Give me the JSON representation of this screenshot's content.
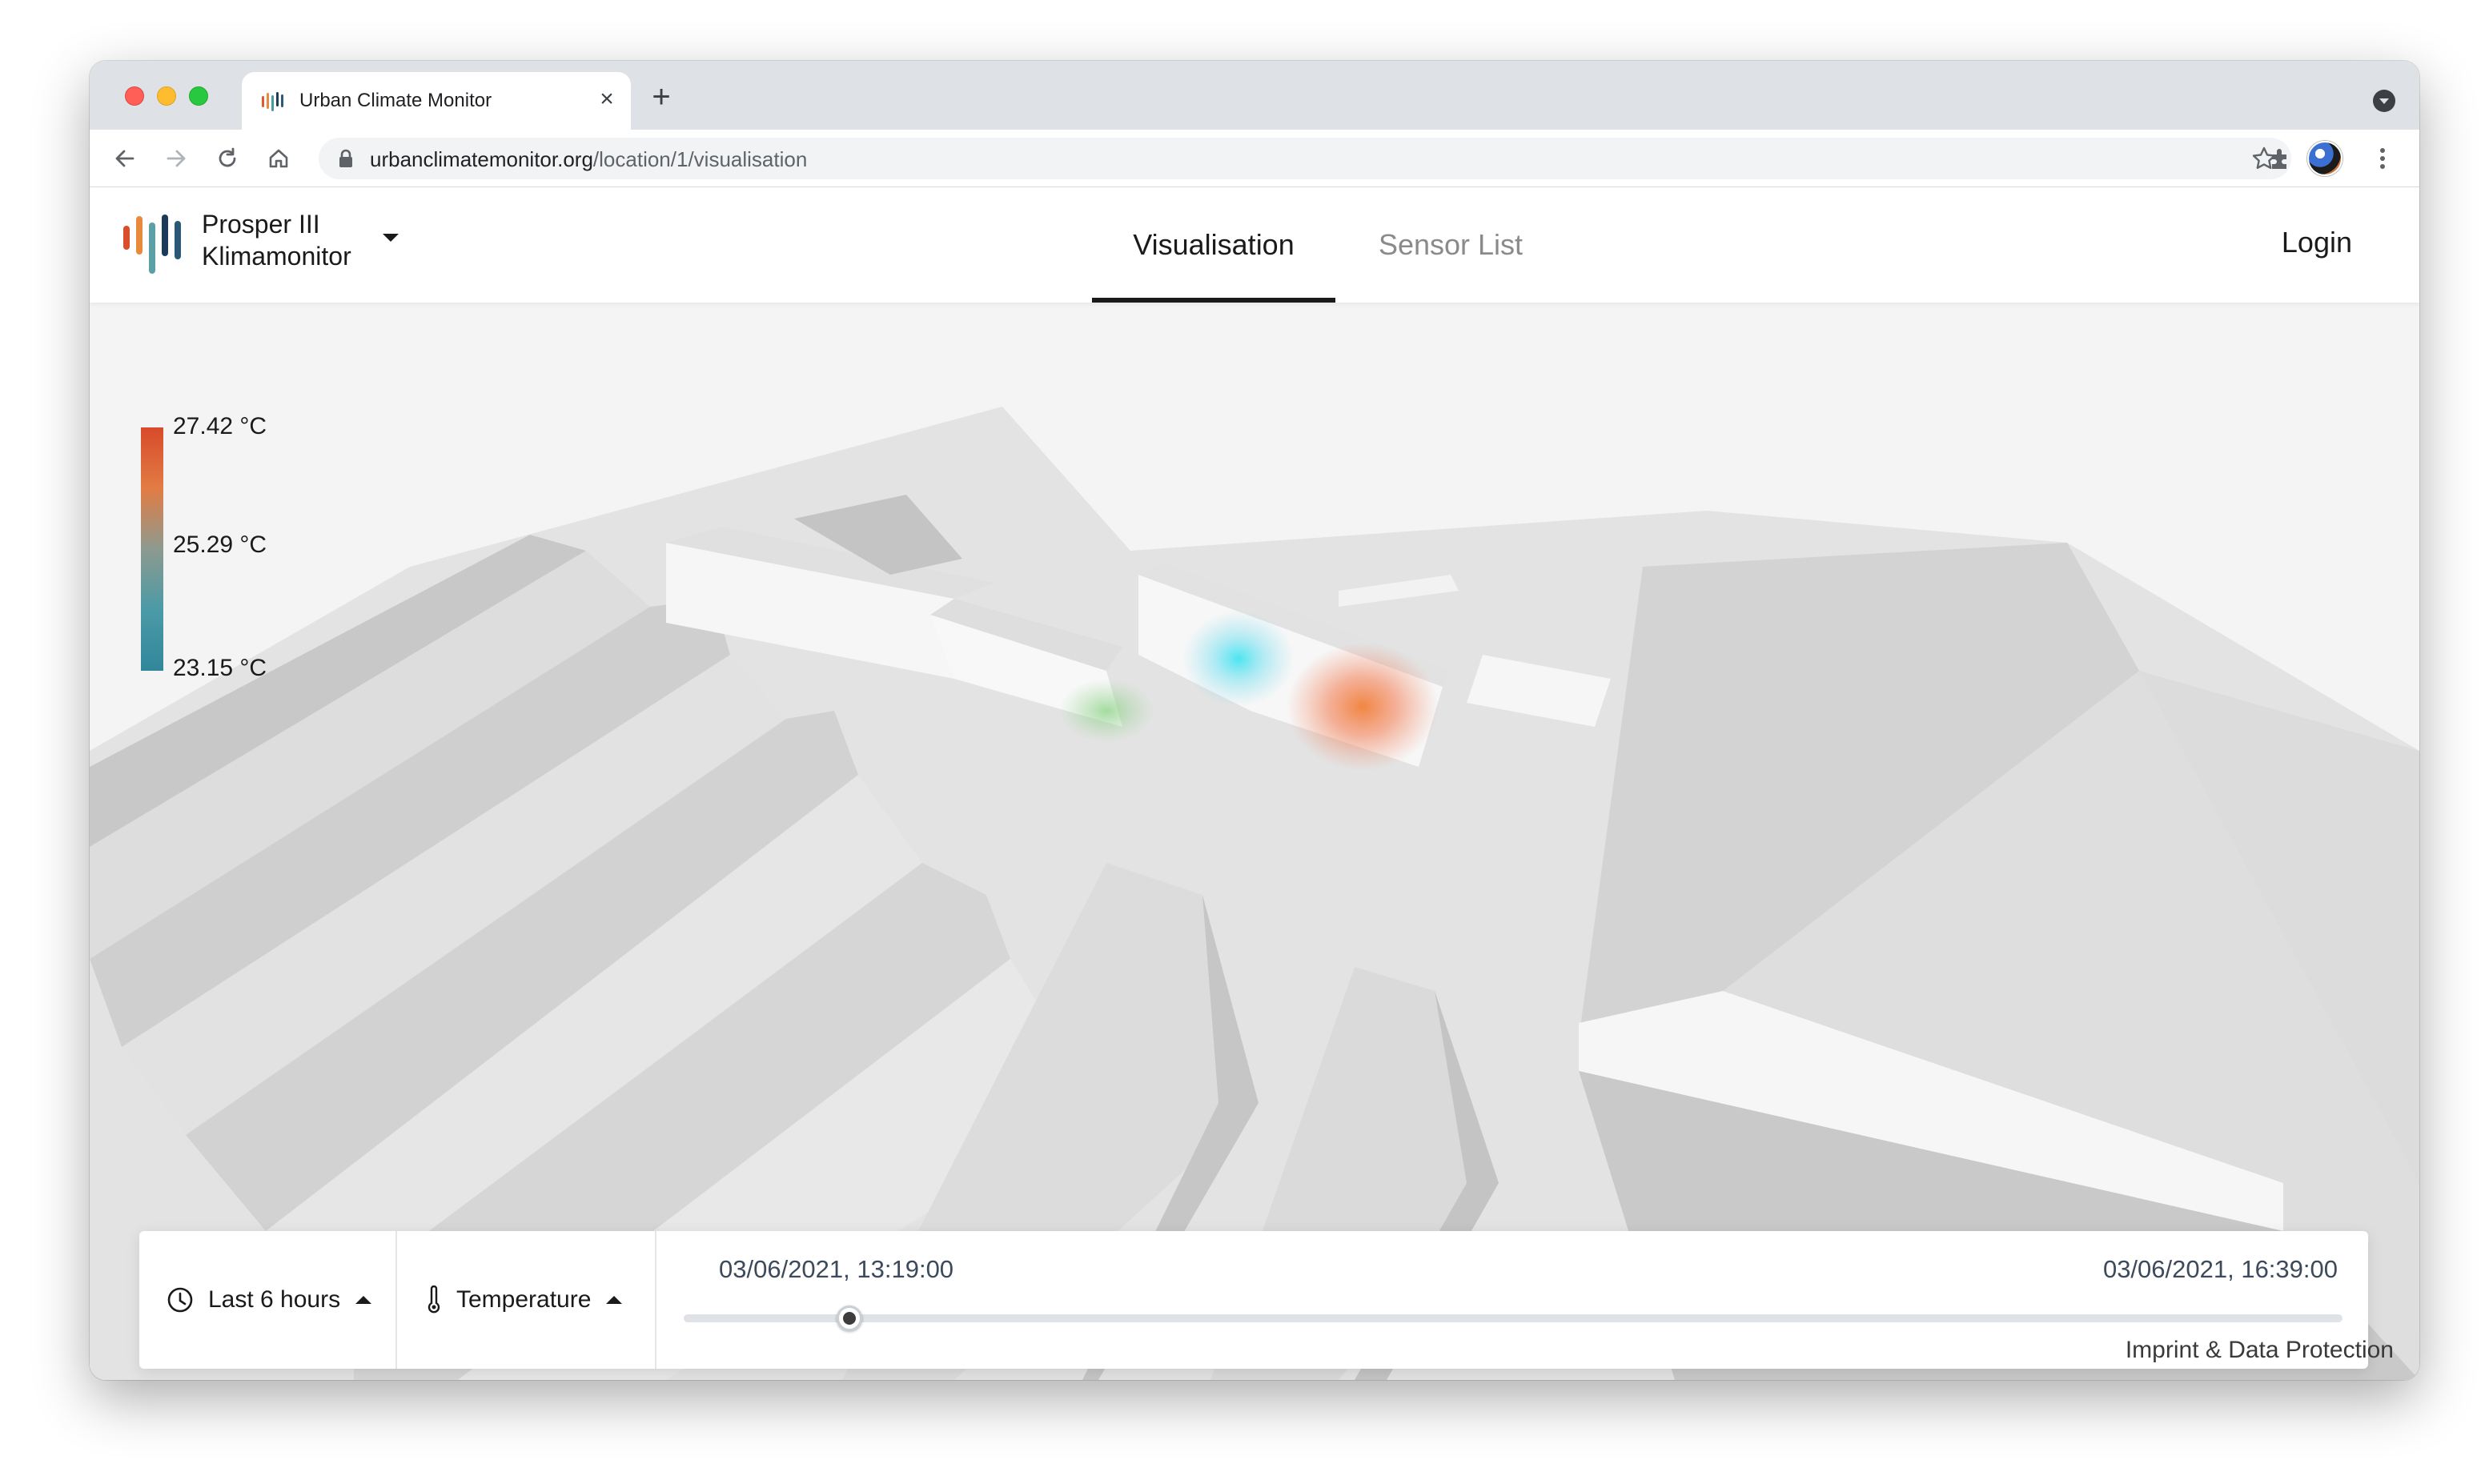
{
  "browser": {
    "tab_title": "Urban Climate Monitor",
    "url_domain": "urbanclimatemonitor.org",
    "url_path": "/location/1/visualisation"
  },
  "site": {
    "brand_line1": "Prosper III",
    "brand_line2": "Klimamonitor",
    "nav": {
      "visualisation": "Visualisation",
      "sensor_list": "Sensor List"
    },
    "login": "Login"
  },
  "legend": {
    "max": "27.42 °C",
    "mid": "25.29 °C",
    "min": "23.15 °C",
    "colors": {
      "high": "#d84a2b",
      "mid": "#8d9a8f",
      "low": "#31879a"
    }
  },
  "controls": {
    "time_range": "Last 6 hours",
    "metric": "Temperature",
    "slider": {
      "start": "03/06/2021, 13:19:00",
      "end": "03/06/2021, 16:39:00",
      "position_fraction": 0.1
    }
  },
  "footer": {
    "imprint": "Imprint & Data Protection"
  },
  "icons": [
    "back-icon",
    "forward-icon",
    "reload-icon",
    "home-icon",
    "lock-icon",
    "star-icon",
    "extensions-icon",
    "menu-icon",
    "clock-icon",
    "thermometer-icon",
    "caret-up-icon",
    "chevron-down-icon"
  ]
}
